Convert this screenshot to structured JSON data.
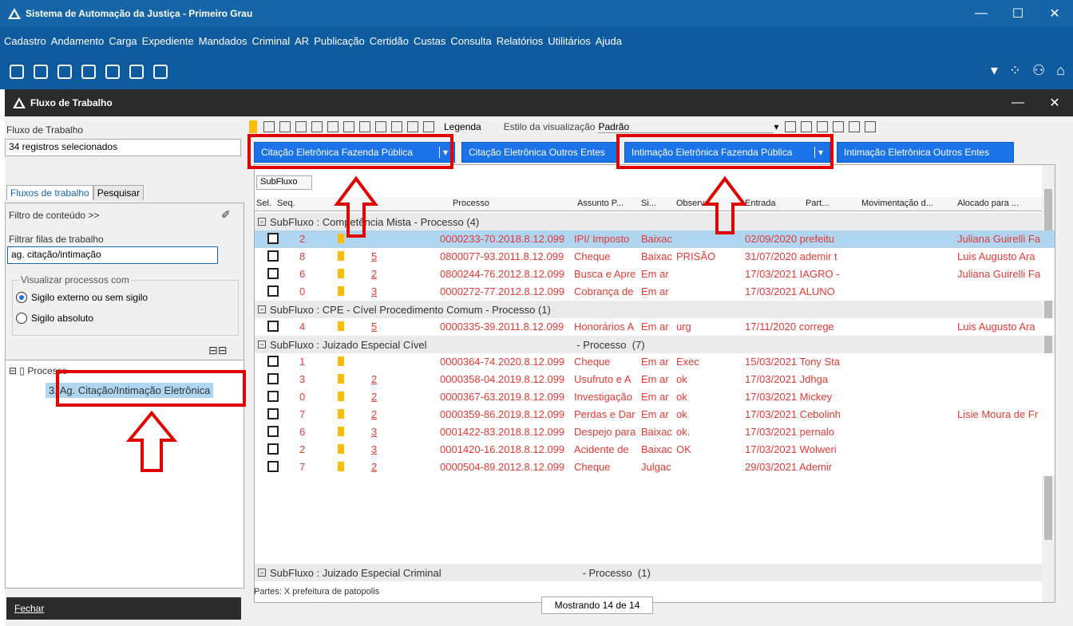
{
  "window": {
    "title": "Sistema de Automação da Justiça - Primeiro Grau"
  },
  "menu": [
    "Cadastro",
    "Andamento",
    "Carga",
    "Expediente",
    "Mandados",
    "Criminal",
    "AR",
    "Publicação",
    "Certidão",
    "Custas",
    "Consulta",
    "Relatórios",
    "Utilitários",
    "Ajuda"
  ],
  "subwindow": {
    "title": "Fluxo de Trabalho"
  },
  "left": {
    "fluxo_label": "Fluxo de Trabalho",
    "fluxo_value": "34 registros selecionados",
    "tab_fluxos": "Fluxos de trabalho",
    "tab_pesquisar": "Pesquisar",
    "filtro_conteudo": "Filtro de conteúdo >>",
    "filtrar_label": "Filtrar filas de trabalho",
    "filtrar_value": "ag. citação/intimação",
    "visualizar_label": "Visualizar processos com",
    "radio1": "Sigilo externo ou sem sigilo",
    "radio2": "Sigilo absoluto",
    "tree_root": "Processo",
    "tree_item": "3. Ag. Citação/Intimação Eletrônica",
    "fechar": "Fechar"
  },
  "right": {
    "legenda": "Legenda",
    "estilo_label": "Estilo da visualização",
    "estilo_value": "Padrão",
    "btn1": "Citação Eletrônica Fazenda Pública",
    "btn2": "Citação Eletrônica Outros Entes",
    "btn3": "Intimação Eletrônica Fazenda Pública",
    "btn4": "Intimação Eletrônica Outros Entes",
    "subfluxo_tag": "SubFluxo",
    "headers": {
      "sel": "Sel.",
      "seq": "Seq.",
      "processo": "Processo",
      "assunto": "Assunto P...",
      "si": "Si...",
      "observ": "Observa",
      "entrada": "Entrada",
      "part": "Part...",
      "mov": "Movimentação d...",
      "alocado": "Alocado para ..."
    },
    "groups": [
      "SubFluxo : Competência Mista - Processo  (4)",
      "SubFluxo : CPE - Cível Procedimento Comum - Processo  (1)",
      "SubFluxo : Juizado Especial Cível                                                    - Processo  (7)",
      "SubFluxo : Juizado Especial Criminal                                                 - Processo  (1)"
    ],
    "rows": [
      {
        "seq": "2",
        "n": "",
        "proc": "0000233-70.2018.8.12.099",
        "assunto": "IPI/ Imposto",
        "si": "Baixac",
        "obs": "",
        "entrada": "02/09/2020 prefeitu",
        "aloc": "Juliana Guirelli Fa"
      },
      {
        "seq": "8",
        "n": "5",
        "proc": "0800077-93.2011.8.12.099",
        "assunto": "Cheque",
        "si": "Baixac",
        "obs": "PRISÃO",
        "entrada": "31/07/2020 ademir t",
        "aloc": "Luis Augusto Ara"
      },
      {
        "seq": "6",
        "n": "2",
        "proc": "0800244-76.2012.8.12.099",
        "assunto": "Busca e Apre",
        "si": "Em ar",
        "obs": "",
        "entrada": "17/03/2021 IAGRO -",
        "aloc": "Juliana Guirelli Fa"
      },
      {
        "seq": "0",
        "n": "3",
        "proc": "0000272-77.2012.8.12.099",
        "assunto": "Cobrança de",
        "si": "Em ar",
        "obs": "",
        "entrada": "17/03/2021 ALUNO",
        "aloc": ""
      },
      {
        "seq": "4",
        "n": "5",
        "proc": "0000335-39.2011.8.12.099",
        "assunto": "Honorários A",
        "si": "Em ar",
        "obs": "urg",
        "entrada": "17/11/2020 correge",
        "aloc": "Luis Augusto Ara"
      },
      {
        "seq": "1",
        "n": "",
        "proc": "0000364-74.2020.8.12.099",
        "assunto": "Cheque",
        "si": "Em ar",
        "obs": "Exec",
        "entrada": "15/03/2021 Tony Sta",
        "aloc": ""
      },
      {
        "seq": "3",
        "n": "2",
        "proc": "0000358-04.2019.8.12.099",
        "assunto": "Usufruto e A",
        "si": "Em ar",
        "obs": "ok",
        "entrada": "17/03/2021 Jdhga",
        "aloc": ""
      },
      {
        "seq": "0",
        "n": "2",
        "proc": "0000367-63.2019.8.12.099",
        "assunto": "Investigação",
        "si": "Em ar",
        "obs": "ok",
        "entrada": "17/03/2021 Mickey",
        "aloc": ""
      },
      {
        "seq": "7",
        "n": "2",
        "proc": "0000359-86.2019.8.12.099",
        "assunto": "Perdas e Dar",
        "si": "Em ar",
        "obs": "ok",
        "entrada": "17/03/2021 Cebolinh",
        "aloc": "Lisie Moura de Fr"
      },
      {
        "seq": "6",
        "n": "3",
        "proc": "0001422-83.2018.8.12.099",
        "assunto": "Despejo para",
        "si": "Baixac",
        "obs": "ok.",
        "entrada": "17/03/2021 pernalo",
        "aloc": ""
      },
      {
        "seq": "2",
        "n": "3",
        "proc": "0001420-16.2018.8.12.099",
        "assunto": "Acidente de",
        "si": "Baixac",
        "obs": "OK",
        "entrada": "17/03/2021 Wolweri",
        "aloc": ""
      },
      {
        "seq": "7",
        "n": "2",
        "proc": "0000504-89.2012.8.12.099",
        "assunto": "Cheque",
        "si": "Julgac",
        "obs": "",
        "entrada": "29/03/2021 Ademir",
        "aloc": ""
      }
    ],
    "partes": "Partes:  X  prefeitura de patopolis",
    "mostrando": "Mostrando 14 de 14"
  },
  "colors": {
    "titlebar": "#1565a8",
    "accent": "#1a73e8",
    "rowtext": "#e53935",
    "annotation": "#e00000"
  }
}
